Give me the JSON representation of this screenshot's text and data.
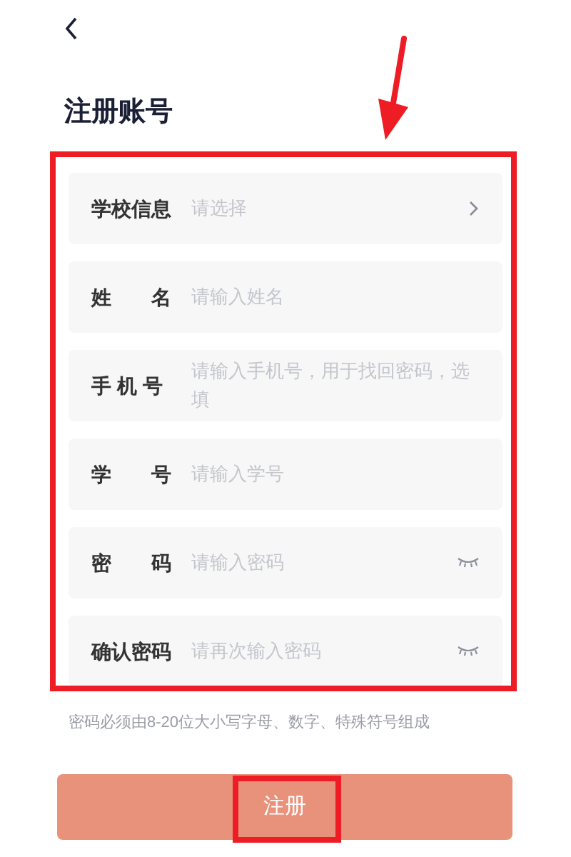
{
  "title": "注册账号",
  "fields": [
    {
      "kind": "select",
      "label": "学校信息",
      "placeholder": "请选择"
    },
    {
      "kind": "text",
      "label": "姓　　名",
      "placeholder": "请输入姓名"
    },
    {
      "kind": "text",
      "label": "手 机 号",
      "placeholder": "请输入手机号，用于找回密码，选填"
    },
    {
      "kind": "text",
      "label": "学　　号",
      "placeholder": "请输入学号"
    },
    {
      "kind": "password",
      "label": "密　　码",
      "placeholder": "请输入密码"
    },
    {
      "kind": "password",
      "label": "确认密码",
      "placeholder": "请再次输入密码"
    }
  ],
  "hint": "密码必须由8-20位大小写字母、数字、特殊符号组成",
  "submit": "注册"
}
